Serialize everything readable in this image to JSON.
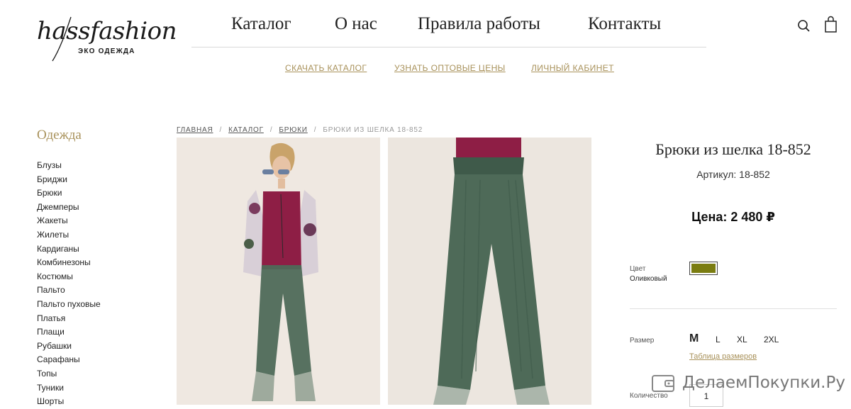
{
  "logo": {
    "script": "hassfashion",
    "subtitle": "ЭКО ОДЕЖДА"
  },
  "topnav": [
    "Каталог",
    "О нас",
    "Правила работы",
    "Контакты"
  ],
  "subnav": [
    "СКАЧАТЬ КАТАЛОГ",
    "УЗНАТЬ ОПТОВЫЕ ЦЕНЫ",
    "ЛИЧНЫЙ КАБИНЕТ"
  ],
  "header_icons": [
    "search-icon",
    "shopping-bag-icon"
  ],
  "sidebar": {
    "title": "Одежда",
    "items": [
      "Блузы",
      "Бриджи",
      "Брюки",
      "Джемперы",
      "Жакеты",
      "Жилеты",
      "Кардиганы",
      "Комбинезоны",
      "Костюмы",
      "Пальто",
      "Пальто пуховые",
      "Платья",
      "Плащи",
      "Рубашки",
      "Сарафаны",
      "Топы",
      "Туники",
      "Шорты"
    ]
  },
  "breadcrumb": [
    "ГЛАВНАЯ",
    "КАТАЛОГ",
    "БРЮКИ",
    "БРЮКИ ИЗ ШЕЛКА 18-852"
  ],
  "product": {
    "title": "Брюки из шелка 18-852",
    "sku": "Артикул: 18-852",
    "price": "Цена: 2 480 ₽",
    "color_label": "Цвет",
    "color_value": "Оливковый",
    "color_hex": "#7a7c10",
    "size_label": "Размер",
    "sizes": [
      "M",
      "L",
      "XL",
      "2XL"
    ],
    "selected_size": "M",
    "size_table": "Таблица размеров",
    "qty_label": "Количество",
    "qty_value": "1"
  },
  "watermark": "ДелаемПокупки.Ру",
  "colors": {
    "accent": "#a8915a",
    "pants_green": "#4e6a58",
    "top_burgundy": "#8e1e45"
  }
}
